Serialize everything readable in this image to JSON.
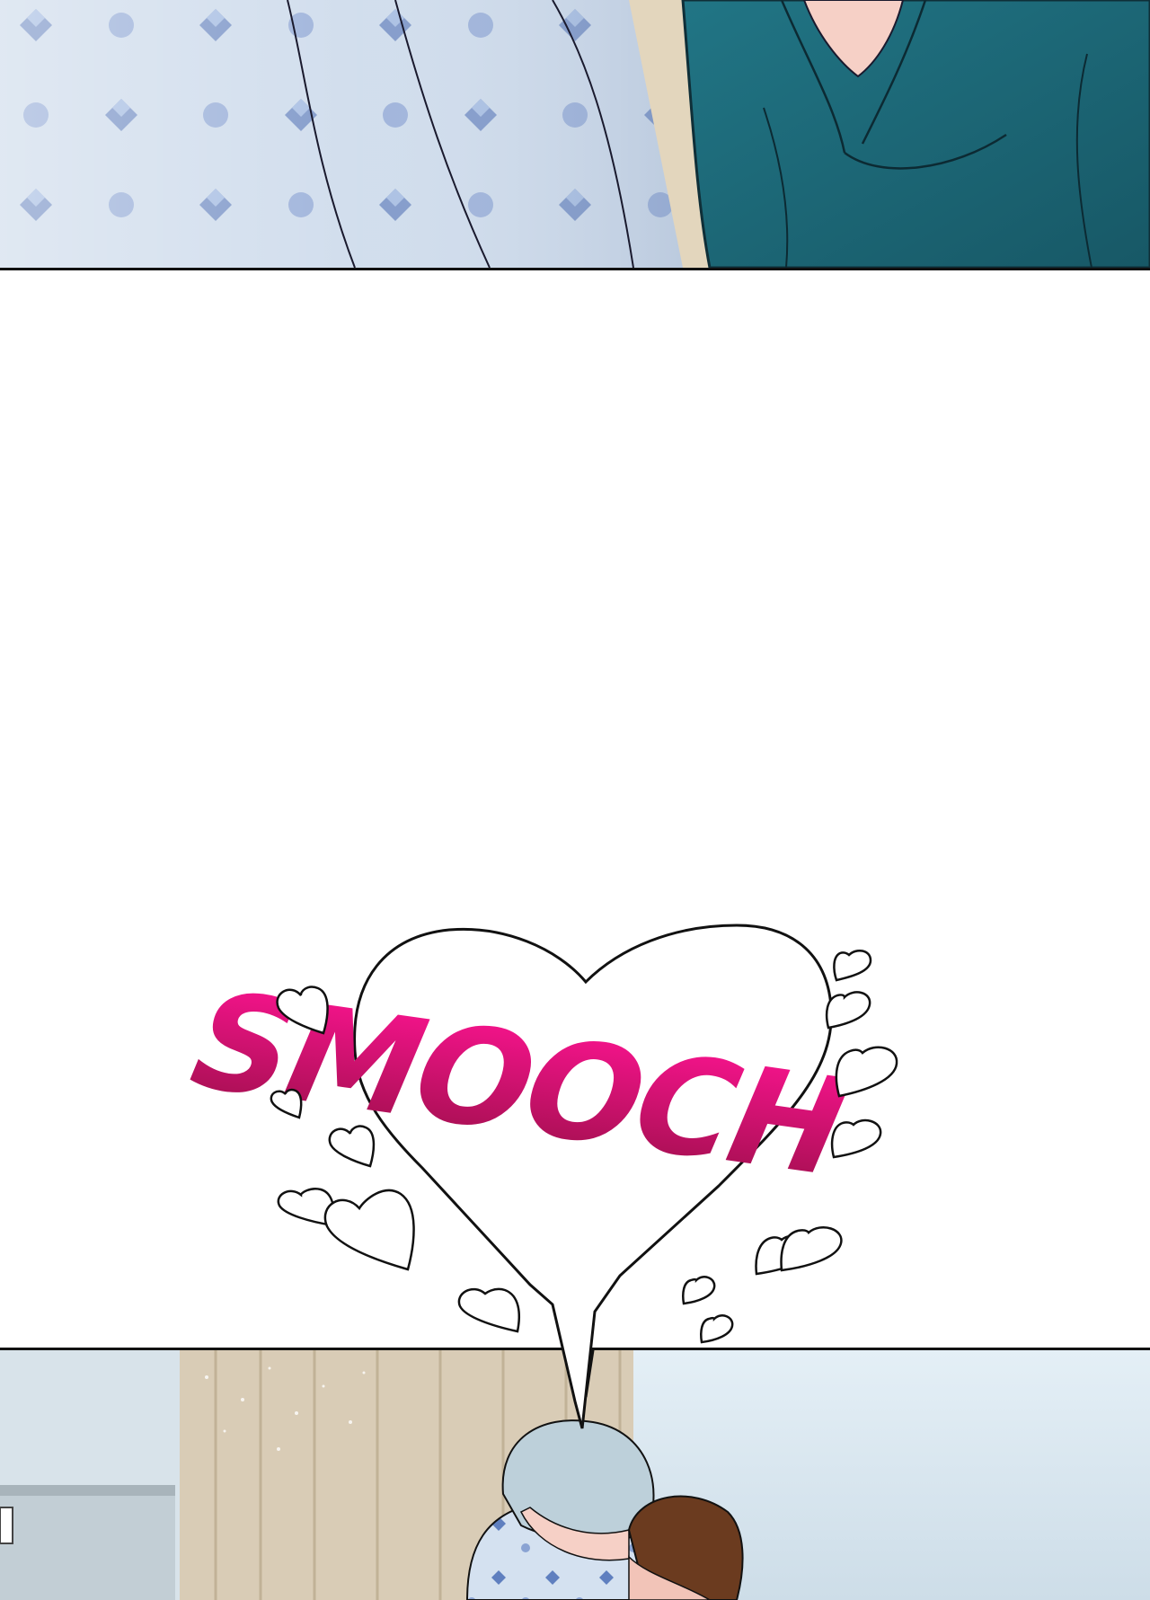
{
  "comic": {
    "sfx": {
      "text": "SMOOCH",
      "color_top": "#ff1493",
      "color_bottom": "#9c0f4a"
    },
    "palette": {
      "gown_blue": "#c9d9ea",
      "gown_pattern": "#7a93c4",
      "jacket_teal": "#1f6a78",
      "skin": "#f6d0c6",
      "curtain": "#d6c9b4",
      "wall_blue": "#dbe9f2",
      "hair_silver": "#b9ccd6",
      "hair_brown": "#6b3b1f",
      "outline": "#111111"
    }
  }
}
